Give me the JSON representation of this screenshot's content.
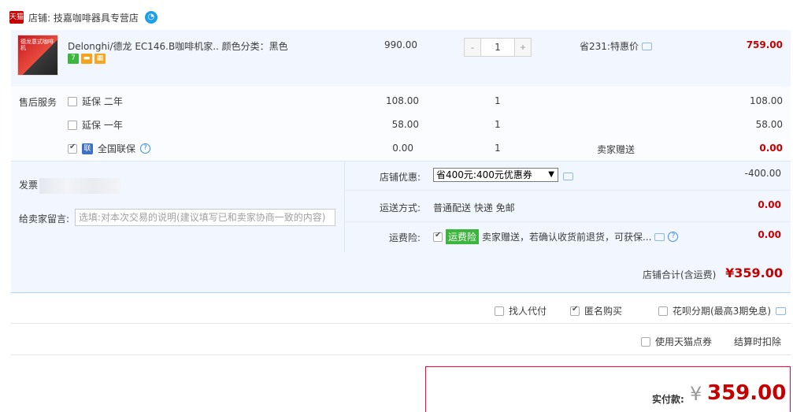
{
  "shop": {
    "badge": "天猫",
    "name": "店铺: 技嘉咖啡器具专营店",
    "ww": "◔"
  },
  "product": {
    "image_text": "德龙意式咖啡机",
    "title": "Delonghi/德龙 EC146.B咖啡机家..  颜色分类：黑色",
    "tags": [
      "7",
      "▬",
      "▦"
    ],
    "price": "990.00",
    "qty": "1",
    "qty_minus": "-",
    "qty_plus": "+",
    "promo": "省231:特惠价",
    "subtotal": "759.00"
  },
  "services": {
    "label": "售后服务",
    "items": [
      {
        "name": "延保 二年",
        "price": "108.00",
        "qty": "1",
        "note": "",
        "subtotal": "108.00",
        "checked": false
      },
      {
        "name": "延保 一年",
        "price": "58.00",
        "qty": "1",
        "note": "",
        "subtotal": "58.00",
        "checked": false
      },
      {
        "name": "全国联保",
        "badge": "联",
        "price": "0.00",
        "qty": "1",
        "note": "卖家赠送",
        "subtotal": "0.00",
        "checked": true
      }
    ],
    "help": "?"
  },
  "invoice": {
    "label": "发票"
  },
  "memo": {
    "label": "给卖家留言:",
    "placeholder": "选填:对本次交易的说明(建议填写已和卖家协商一致的内容)"
  },
  "discount": {
    "label": "店铺优惠:",
    "selected": "省400元:400元优惠券",
    "arrow": "▼",
    "amount": "-400.00"
  },
  "shipping": {
    "label": "运送方式:",
    "value": "普通配送 快递 免邮",
    "amount": "0.00"
  },
  "freight_insurance": {
    "label": "运费险:",
    "badge": "运费险",
    "text": "卖家赠送，若确认收货前退货，可获保...",
    "amount": "0.00"
  },
  "shop_total": {
    "label": "店铺合计(含运费)",
    "amount": "¥359.00"
  },
  "options": {
    "agent": "找人代付",
    "anonymous": "匿名购买",
    "huabei": "花呗分期(最高3期免息)",
    "tmall_points": "使用天猫点券",
    "deduct_note": "结算时扣除"
  },
  "payment": {
    "label": "实付款:",
    "currency": "¥",
    "amount": "359.00"
  },
  "colors": {
    "accent_red": "#c40000",
    "panel_blue": "#f2f7ff",
    "border_blue": "#b2d1ff",
    "insurance_green": "#3bb53c"
  }
}
